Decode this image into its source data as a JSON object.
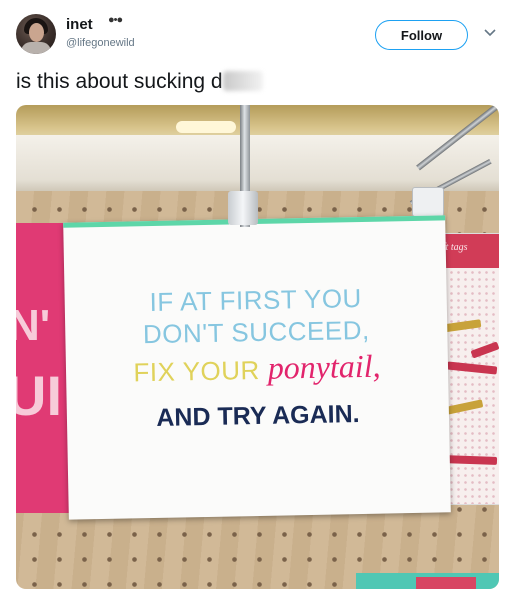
{
  "user": {
    "display_name": "inet",
    "handle": "@lifegonewild",
    "follow_label": "Follow"
  },
  "tweet": {
    "text": "is this about sucking d"
  },
  "photo": {
    "sign_lines": {
      "line1": "IF AT FIRST YOU",
      "line2": "DON'T SUCCEED,",
      "line3a": "FIX YOUR",
      "line3b": "ponytail,",
      "line4": "AND TRY AGAIN."
    },
    "card_label": "gift tags",
    "pink_card_letters": "N' U",
    "colors": {
      "sign_blue": "#86c6e0",
      "sign_yellow": "#e0d25a",
      "sign_pink": "#e2246c",
      "sign_navy": "#1a2b55",
      "accent": "#1da1f2"
    }
  }
}
